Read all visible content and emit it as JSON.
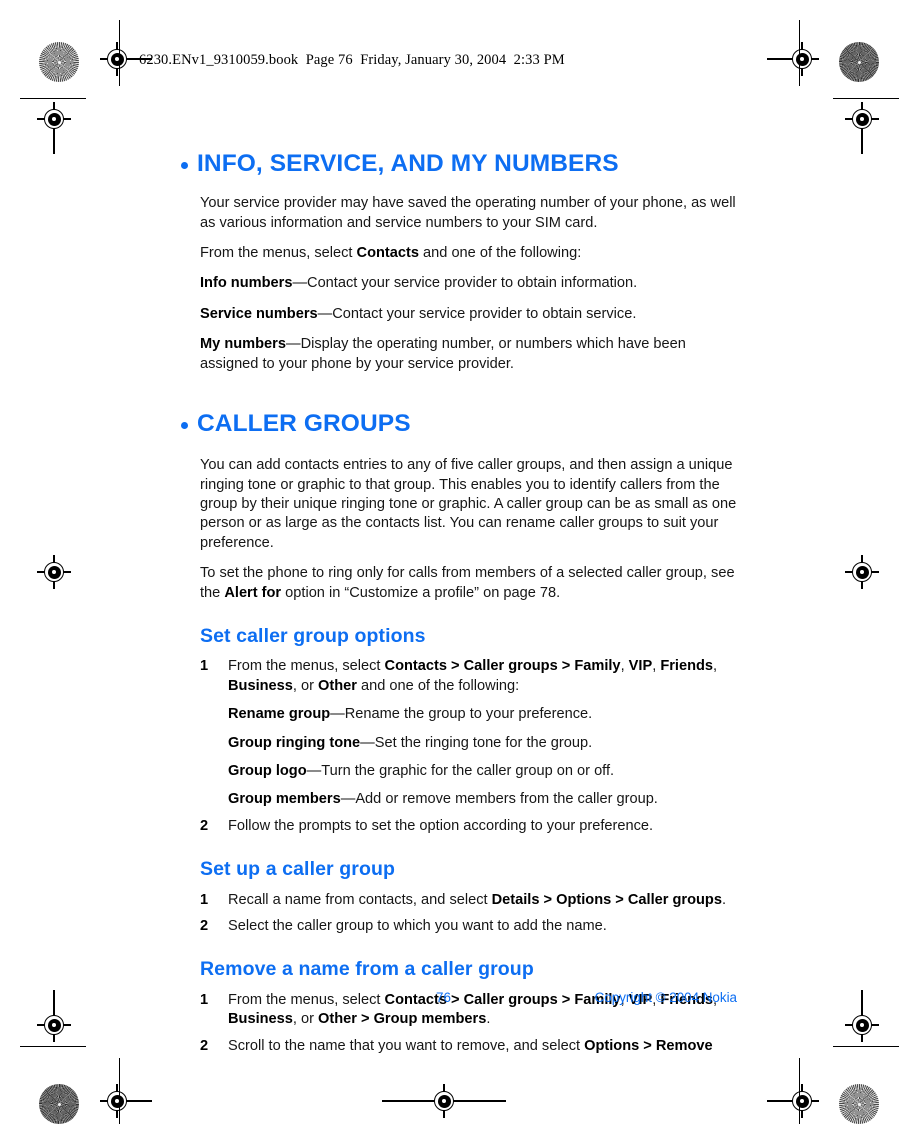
{
  "file_header": "6230.ENv1_9310059.book  Page 76  Friday, January 30, 2004  2:33 PM",
  "colors": {
    "heading_blue": "#0d6ef2",
    "body_black": "#161616",
    "page_background": "#ffffff"
  },
  "sections": [
    {
      "id": "info-service-my-numbers",
      "title": "INFO, SERVICE, AND MY NUMBERS",
      "paragraphs": [
        "Your service provider may have saved the operating number of your phone, as well as various information and service numbers to your SIM card."
      ],
      "lead_in": {
        "before": "From the menus, select ",
        "bold": "Contacts",
        "after": " and one of the following:"
      },
      "definitions": [
        {
          "term": "Info numbers",
          "desc": "—Contact your service provider to obtain information."
        },
        {
          "term": "Service numbers",
          "desc": "—Contact your service provider to obtain service."
        },
        {
          "term": "My numbers",
          "desc": "—Display the operating number, or numbers which have been assigned to your phone by your service provider."
        }
      ]
    },
    {
      "id": "caller-groups",
      "title": "CALLER GROUPS",
      "paragraphs": [
        "You can add contacts entries to any of five caller groups, and then assign a unique ringing tone or graphic to that group. This enables you to identify callers from the group by their unique ringing tone or graphic. A caller group can be as small as one person or as large as the contacts list. You can rename caller groups to suit your preference."
      ],
      "cross_reference": {
        "before": "To set the phone to ring only for calls from members of a selected caller group, see the ",
        "bold": "Alert for",
        "after": " option in “Customize a profile” on page 78."
      }
    }
  ],
  "subsections": [
    {
      "id": "set-caller-group-options",
      "title": "Set caller group options",
      "steps": [
        {
          "num": "1",
          "parts": [
            {
              "text": "From the menus, select ",
              "bold": false
            },
            {
              "text": "Contacts > Caller groups > Family",
              "bold": true
            },
            {
              "text": ", ",
              "bold": false
            },
            {
              "text": "VIP",
              "bold": true
            },
            {
              "text": ", ",
              "bold": false
            },
            {
              "text": "Friends",
              "bold": true
            },
            {
              "text": ", ",
              "bold": false
            },
            {
              "text": "Business",
              "bold": true
            },
            {
              "text": ", or ",
              "bold": false
            },
            {
              "text": "Other",
              "bold": true
            },
            {
              "text": " and one of the following:",
              "bold": false
            }
          ],
          "subdefinitions": [
            {
              "term": "Rename group",
              "desc": "—Rename the group to your preference."
            },
            {
              "term": "Group ringing tone",
              "desc": "—Set the ringing tone for the group."
            },
            {
              "term": "Group logo",
              "desc": "—Turn the graphic for the caller group on or off."
            },
            {
              "term": "Group members",
              "desc": "—Add or remove members from the caller group."
            }
          ]
        },
        {
          "num": "2",
          "parts": [
            {
              "text": "Follow the prompts to set the option according to your preference.",
              "bold": false
            }
          ],
          "subdefinitions": []
        }
      ]
    },
    {
      "id": "set-up-a-caller-group",
      "title": "Set up a caller group",
      "steps": [
        {
          "num": "1",
          "parts": [
            {
              "text": "Recall a name from contacts, and select ",
              "bold": false
            },
            {
              "text": "Details > Options > Caller groups",
              "bold": true
            },
            {
              "text": ".",
              "bold": false
            }
          ],
          "subdefinitions": []
        },
        {
          "num": "2",
          "parts": [
            {
              "text": "Select the caller group to which you want to add the name.",
              "bold": false
            }
          ],
          "subdefinitions": []
        }
      ]
    },
    {
      "id": "remove-a-name-from-a-caller-group",
      "title": "Remove a name from a caller group",
      "steps": [
        {
          "num": "1",
          "parts": [
            {
              "text": "From the menus, select ",
              "bold": false
            },
            {
              "text": "Contacts > Caller groups > Family",
              "bold": true
            },
            {
              "text": ", ",
              "bold": false
            },
            {
              "text": "VIP",
              "bold": true
            },
            {
              "text": ", ",
              "bold": false
            },
            {
              "text": "Friends",
              "bold": true
            },
            {
              "text": ", ",
              "bold": false
            },
            {
              "text": "Business",
              "bold": true
            },
            {
              "text": ", or ",
              "bold": false
            },
            {
              "text": "Other > Group members",
              "bold": true
            },
            {
              "text": ".",
              "bold": false
            }
          ],
          "subdefinitions": []
        },
        {
          "num": "2",
          "parts": [
            {
              "text": "Scroll to the name that you want to remove, and select ",
              "bold": false
            },
            {
              "text": "Options > Remove",
              "bold": true
            }
          ],
          "subdefinitions": []
        }
      ]
    }
  ],
  "footer": {
    "page_number": "76",
    "copyright": "Copyright © 2004 Nokia"
  }
}
